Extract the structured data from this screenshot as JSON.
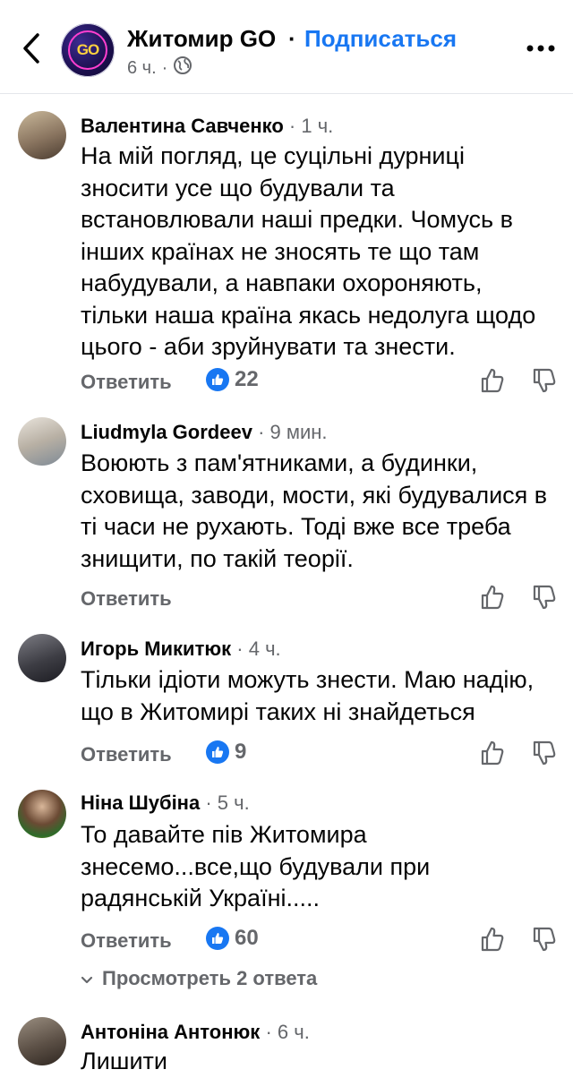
{
  "header": {
    "page_name": "Житомир GO",
    "separator": "·",
    "follow_label": "Подписаться",
    "time": "6 ч.",
    "meta_dot": "·",
    "logo_text": "GO"
  },
  "comments": [
    {
      "author": "Валентина Савченко",
      "time": " · 1 ч.",
      "text": "На мій погляд,  це суцільні дурниці\nзносити усе що будували та\nвстановлювали наші предки. Чомусь в\nінших країнах не зносять те  що там\nнабудували, а навпаки охороняють,\nтільки наша країна якась недолуга щодо\nцього - аби зруйнувати та знести.",
      "reply_label": "Ответить",
      "likes": "22"
    },
    {
      "author": "Liudmyla Gordeev",
      "time": " · 9 мин.",
      "text": "Воюють з пам'ятниками, а будинки,\nсховища, заводи, мости, які будувалися в\nті часи не рухають. Тоді вже все треба\nзнищити, по такій теорії.",
      "reply_label": "Ответить",
      "likes": ""
    },
    {
      "author": "Игорь Микитюк",
      "time": " · 4 ч.",
      "text": "Тільки ідіоти можуть знести. Маю надію,\nщо в Житомирі таких ні знайдеться",
      "reply_label": "Ответить",
      "likes": "9"
    },
    {
      "author": "Ніна Шубіна",
      "time": " · 5 ч.",
      "text": "То давайте пів Житомира\nзнесемо...все,що будували при\nрадянській Україні.....",
      "reply_label": "Ответить",
      "likes": "60"
    },
    {
      "author": "Антоніна Антонюк",
      "time": " · 6 ч.",
      "text": "Лишити",
      "reply_label": "",
      "likes": ""
    }
  ],
  "view_replies_label": "Просмотреть 2 ответа",
  "colors": {
    "accent": "#1877f2",
    "secondary_text": "#65676b",
    "divider": "#e4e6eb"
  }
}
